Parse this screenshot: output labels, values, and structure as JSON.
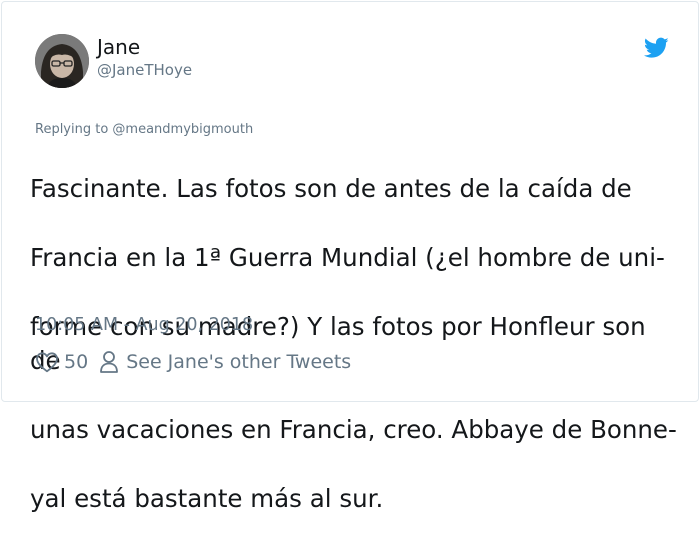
{
  "tweet": {
    "author": {
      "display_name": "Jane",
      "handle": "@JaneTHoye"
    },
    "reply_context": "Replying to @meandmybigmouth",
    "text_lines": [
      "Fascinante. Las fotos son de antes de la caída de",
      "Francia en la 1ª Guerra Mundial (¿el hombre de uni-",
      "forme con su madre?) Y las fotos por Honfleur son de",
      "unas vacaciones en Francia, creo. Abbaye de Bonne-",
      "yal está bastante más al sur."
    ],
    "timestamp": "10:05 AM - Aug 20, 2018",
    "likes": "50",
    "other_tweets_label": "See Jane's other Tweets"
  },
  "icons": {
    "brand": "twitter-bird-icon",
    "like": "heart-outline-icon",
    "profile": "person-outline-icon"
  },
  "colors": {
    "brand": "#1da1f2",
    "text_primary": "#14171a",
    "text_secondary": "#657786",
    "border": "#e1e8ed"
  }
}
